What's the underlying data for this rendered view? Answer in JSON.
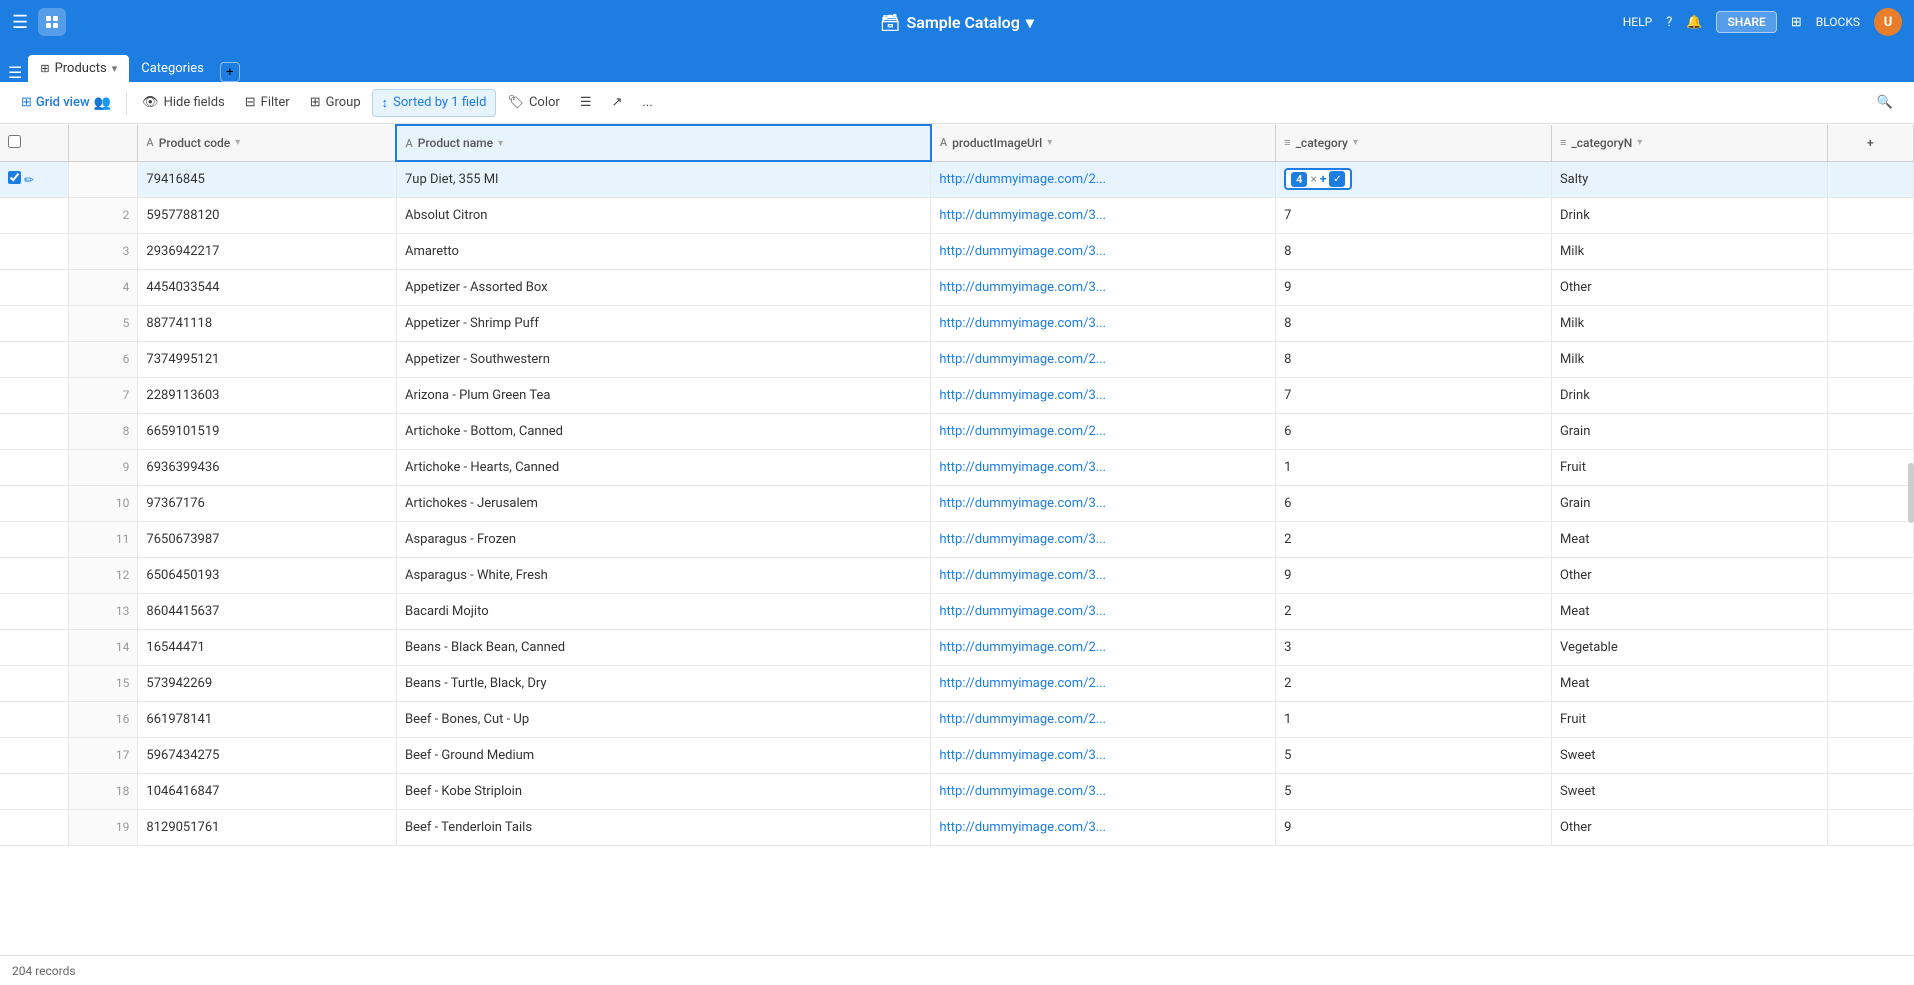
{
  "app": {
    "logo": "🗃",
    "catalog_name": "Sample Catalog",
    "catalog_dropdown": "▾",
    "help": "HELP",
    "share_label": "SHARE",
    "blocks_label": "BLOCKS"
  },
  "tabs": {
    "active": "Products",
    "items": [
      {
        "label": "Products",
        "active": true
      },
      {
        "label": "Categories",
        "active": false
      }
    ],
    "add_tooltip": "Add table"
  },
  "toolbar": {
    "view_label": "Grid view",
    "hide_fields": "Hide fields",
    "filter": "Filter",
    "group": "Group",
    "sort_label": "Sorted by 1 field",
    "color": "Color",
    "row_height": "",
    "share_view": "",
    "more": "..."
  },
  "table": {
    "columns": [
      {
        "key": "checkbox",
        "label": "",
        "type": "checkbox"
      },
      {
        "key": "rownum",
        "label": "",
        "type": "rownum"
      },
      {
        "key": "product_code",
        "label": "Product code",
        "type": "text"
      },
      {
        "key": "product_name",
        "label": "Product name",
        "type": "text"
      },
      {
        "key": "product_image_url",
        "label": "productImageUrl",
        "type": "text"
      },
      {
        "key": "_category",
        "label": "_category",
        "type": "list"
      },
      {
        "key": "_categoryN",
        "label": "_categoryN",
        "type": "list"
      },
      {
        "key": "add",
        "label": "+",
        "type": "add"
      }
    ],
    "rows": [
      {
        "rownum": "",
        "selected": true,
        "product_code": "79416845",
        "product_name": "7up Diet, 355 Ml",
        "image_url": "http://dummyimage.com/2...",
        "category": "4",
        "categoryN": "Salty",
        "sort_active": true
      },
      {
        "rownum": "2",
        "selected": false,
        "product_code": "5957788120",
        "product_name": "Absolut Citron",
        "image_url": "http://dummyimage.com/3...",
        "category": "7",
        "categoryN": "Drink",
        "sort_active": false
      },
      {
        "rownum": "3",
        "selected": false,
        "product_code": "2936942217",
        "product_name": "Amaretto",
        "image_url": "http://dummyimage.com/3...",
        "category": "8",
        "categoryN": "Milk",
        "sort_active": false
      },
      {
        "rownum": "4",
        "selected": false,
        "product_code": "4454033544",
        "product_name": "Appetizer - Assorted Box",
        "image_url": "http://dummyimage.com/3...",
        "category": "9",
        "categoryN": "Other",
        "sort_active": false
      },
      {
        "rownum": "5",
        "selected": false,
        "product_code": "887741118",
        "product_name": "Appetizer - Shrimp Puff",
        "image_url": "http://dummyimage.com/3...",
        "category": "8",
        "categoryN": "Milk",
        "sort_active": false
      },
      {
        "rownum": "6",
        "selected": false,
        "product_code": "7374995121",
        "product_name": "Appetizer - Southwestern",
        "image_url": "http://dummyimage.com/2...",
        "category": "8",
        "categoryN": "Milk",
        "sort_active": false
      },
      {
        "rownum": "7",
        "selected": false,
        "product_code": "2289113603",
        "product_name": "Arizona - Plum Green Tea",
        "image_url": "http://dummyimage.com/3...",
        "category": "7",
        "categoryN": "Drink",
        "sort_active": false
      },
      {
        "rownum": "8",
        "selected": false,
        "product_code": "6659101519",
        "product_name": "Artichoke - Bottom, Canned",
        "image_url": "http://dummyimage.com/2...",
        "category": "6",
        "categoryN": "Grain",
        "sort_active": false
      },
      {
        "rownum": "9",
        "selected": false,
        "product_code": "6936399436",
        "product_name": "Artichoke - Hearts, Canned",
        "image_url": "http://dummyimage.com/3...",
        "category": "1",
        "categoryN": "Fruit",
        "sort_active": false
      },
      {
        "rownum": "10",
        "selected": false,
        "product_code": "97367176",
        "product_name": "Artichokes - Jerusalem",
        "image_url": "http://dummyimage.com/3...",
        "category": "6",
        "categoryN": "Grain",
        "sort_active": false
      },
      {
        "rownum": "11",
        "selected": false,
        "product_code": "7650673987",
        "product_name": "Asparagus - Frozen",
        "image_url": "http://dummyimage.com/3...",
        "category": "2",
        "categoryN": "Meat",
        "sort_active": false
      },
      {
        "rownum": "12",
        "selected": false,
        "product_code": "6506450193",
        "product_name": "Asparagus - White, Fresh",
        "image_url": "http://dummyimage.com/3...",
        "category": "9",
        "categoryN": "Other",
        "sort_active": false
      },
      {
        "rownum": "13",
        "selected": false,
        "product_code": "8604415637",
        "product_name": "Bacardi Mojito",
        "image_url": "http://dummyimage.com/3...",
        "category": "2",
        "categoryN": "Meat",
        "sort_active": false
      },
      {
        "rownum": "14",
        "selected": false,
        "product_code": "16544471",
        "product_name": "Beans - Black Bean, Canned",
        "image_url": "http://dummyimage.com/2...",
        "category": "3",
        "categoryN": "Vegetable",
        "sort_active": false
      },
      {
        "rownum": "15",
        "selected": false,
        "product_code": "573942269",
        "product_name": "Beans - Turtle, Black, Dry",
        "image_url": "http://dummyimage.com/2...",
        "category": "2",
        "categoryN": "Meat",
        "sort_active": false
      },
      {
        "rownum": "16",
        "selected": false,
        "product_code": "661978141",
        "product_name": "Beef - Bones, Cut - Up",
        "image_url": "http://dummyimage.com/2...",
        "category": "1",
        "categoryN": "Fruit",
        "sort_active": false
      },
      {
        "rownum": "17",
        "selected": false,
        "product_code": "5967434275",
        "product_name": "Beef - Ground Medium",
        "image_url": "http://dummyimage.com/3...",
        "category": "5",
        "categoryN": "Sweet",
        "sort_active": false
      },
      {
        "rownum": "18",
        "selected": false,
        "product_code": "1046416847",
        "product_name": "Beef - Kobe Striploin",
        "image_url": "http://dummyimage.com/3...",
        "category": "5",
        "categoryN": "Sweet",
        "sort_active": false
      },
      {
        "rownum": "19",
        "selected": false,
        "product_code": "8129051761",
        "product_name": "Beef - Tenderloin Tails",
        "image_url": "http://dummyimage.com/3...",
        "category": "9",
        "categoryN": "Other",
        "sort_active": false
      }
    ],
    "record_count": "204 records"
  }
}
